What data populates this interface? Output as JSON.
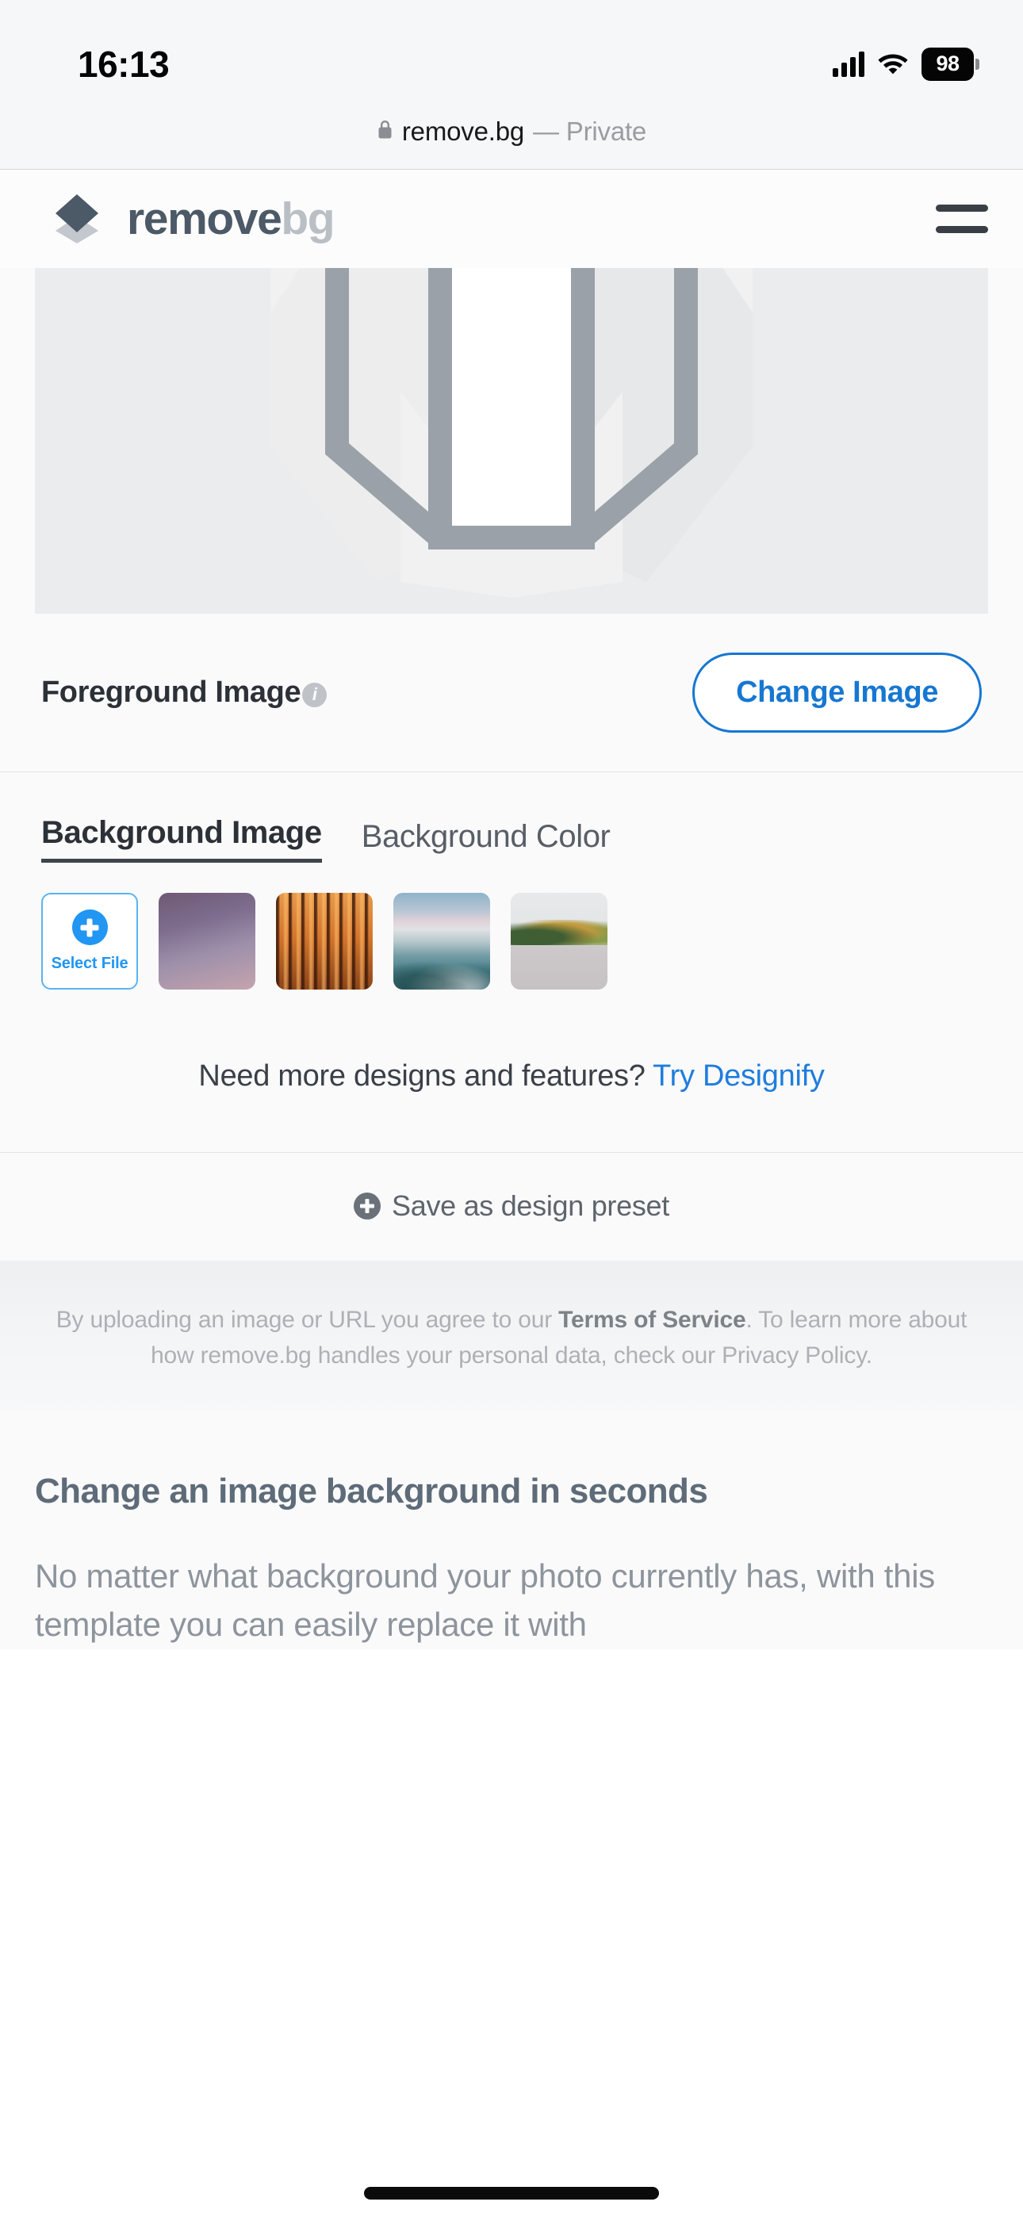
{
  "status_bar": {
    "time": "16:13",
    "battery_percent": "98",
    "signal_icon": "cellular-bars-icon",
    "wifi_icon": "wifi-icon",
    "battery_icon": "battery-icon"
  },
  "browser": {
    "lock_icon": "lock-icon",
    "domain": "remove.bg",
    "private_label": "— Private"
  },
  "header": {
    "logo_icon": "removebg-diamond-logo-icon",
    "brand_primary": "remove",
    "brand_secondary": "bg",
    "menu_icon": "hamburger-menu-icon",
    "logo_primary_color": "#4c5966",
    "logo_secondary_color": "#b9bfc5"
  },
  "preview": {
    "placeholder_icon": "image-placeholder-box-icon"
  },
  "foreground": {
    "label": "Foreground Image",
    "info_icon": "info-icon",
    "change_button": "Change Image",
    "accent_color": "#1677d2"
  },
  "background_section": {
    "tabs": [
      {
        "label": "Background Image",
        "active": true
      },
      {
        "label": "Background Color",
        "active": false
      }
    ],
    "select_file": {
      "icon": "plus-circle-icon",
      "label": "Select File",
      "color": "#2196f3"
    },
    "thumbnails": [
      {
        "name": "purple-gradient-thumbnail"
      },
      {
        "name": "orange-stripes-thumbnail"
      },
      {
        "name": "sea-cityscape-thumbnail"
      },
      {
        "name": "wall-autumn-trees-thumbnail"
      }
    ]
  },
  "promo": {
    "text": "Need more designs and features? ",
    "link": "Try Designify",
    "link_color": "#1f7ddd"
  },
  "save_preset": {
    "icon": "plus-circle-small-icon",
    "label": "Save as design preset"
  },
  "legal": {
    "part1": "By uploading an image or URL you agree to our ",
    "terms": "Terms of Service",
    "part2": ". To learn more about how remove.bg handles your personal data, check our Privacy Policy."
  },
  "article": {
    "heading": "Change an image background in seconds",
    "body": "No matter what background your photo currently has, with this template you can easily replace it with"
  }
}
